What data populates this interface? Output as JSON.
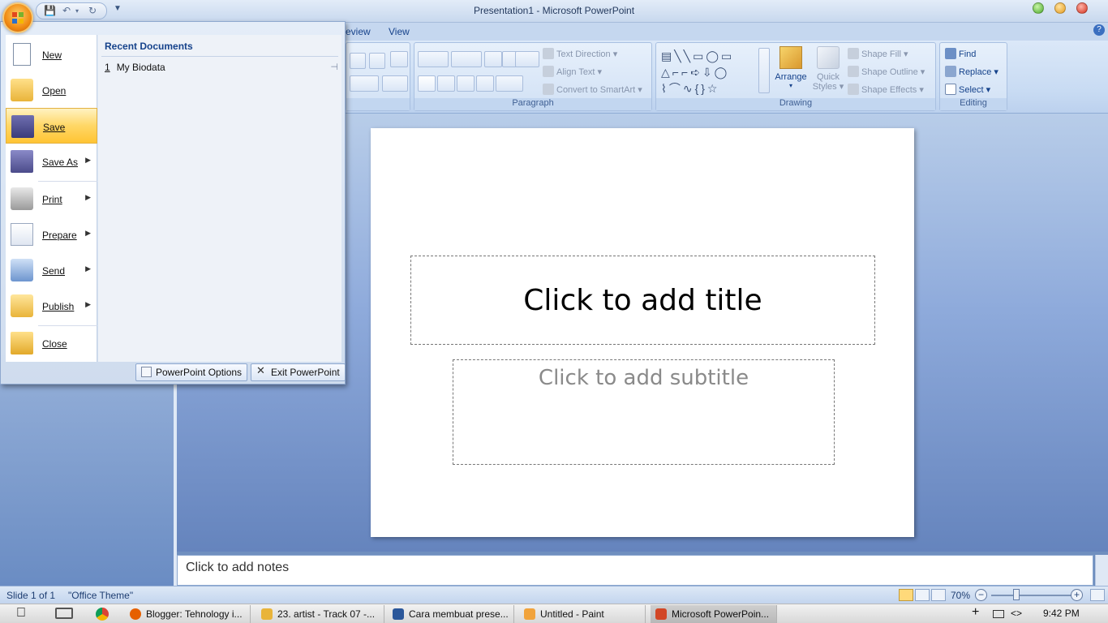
{
  "window": {
    "title": "Presentation1 - Microsoft PowerPoint"
  },
  "ribbon": {
    "tabs": [
      "eview",
      "View"
    ],
    "paragraph": {
      "label": "Paragraph",
      "text_direction": "Text Direction",
      "align_text": "Align Text",
      "convert_smartart": "Convert to SmartArt"
    },
    "drawing": {
      "label": "Drawing",
      "arrange": "Arrange",
      "quick_styles_1": "Quick",
      "quick_styles_2": "Styles",
      "shape_fill": "Shape Fill",
      "shape_outline": "Shape Outline",
      "shape_effects": "Shape Effects"
    },
    "editing": {
      "label": "Editing",
      "find": "Find",
      "replace": "Replace",
      "select": "Select"
    }
  },
  "office_menu": {
    "items": [
      {
        "label": "New"
      },
      {
        "label": "Open"
      },
      {
        "label": "Save"
      },
      {
        "label": "Save As"
      },
      {
        "label": "Print"
      },
      {
        "label": "Prepare"
      },
      {
        "label": "Send"
      },
      {
        "label": "Publish"
      },
      {
        "label": "Close"
      }
    ],
    "recent_header": "Recent Documents",
    "recent": [
      {
        "num": "1",
        "name": "My Biodata"
      }
    ],
    "options_button": "PowerPoint Options",
    "exit_button": "Exit PowerPoint"
  },
  "slide": {
    "title_placeholder": "Click to add title",
    "subtitle_placeholder": "Click to add subtitle"
  },
  "notes": {
    "placeholder": "Click to add notes"
  },
  "statusbar": {
    "slide_info": "Slide 1 of 1",
    "theme": "\"Office Theme\"",
    "zoom": "70%",
    "zoom_level": 0.7
  },
  "taskbar": {
    "tasks": [
      {
        "label": "Blogger: Tehnology i..."
      },
      {
        "label": "23. artist - Track 07 -..."
      },
      {
        "label": "Cara membuat prese..."
      },
      {
        "label": "Untitled - Paint"
      },
      {
        "label": "Microsoft PowerPoin..."
      }
    ],
    "clock": "9:42 PM"
  },
  "colors": {
    "accent_orange": "#f08a12",
    "ribbon_blue": "#c5d7ef",
    "highlight": "#ffd766"
  }
}
